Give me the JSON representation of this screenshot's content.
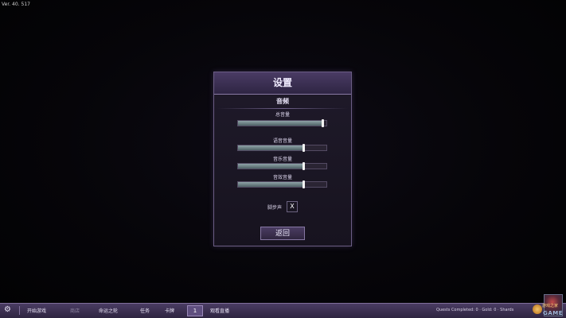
{
  "version": "Ver. 40. 517",
  "settings": {
    "title": "设置",
    "section": "音频",
    "sliders": [
      {
        "label": "总音量",
        "level": 0.96
      },
      {
        "label": "语音音量",
        "level": 0.75
      },
      {
        "label": "音乐音量",
        "level": 0.75
      },
      {
        "label": "音效音量",
        "level": 0.75
      }
    ],
    "footsteps": {
      "label": "脚步声",
      "value": "X"
    },
    "back_label": "返回"
  },
  "bottombar": {
    "gear_icon": "gear-icon",
    "tabs": [
      {
        "label": "开始游戏",
        "dim": false
      },
      {
        "label": "商店",
        "dim": true
      },
      {
        "label": "命运之轮",
        "dim": false
      },
      {
        "label": "任务",
        "dim": false
      },
      {
        "label": "卡牌",
        "dim": false
      },
      {
        "label": "观看直播",
        "dim": false
      }
    ],
    "indicator": "1",
    "status": "Quests Completed: 0 · Gold: 0 · Shards"
  },
  "watermark": {
    "cn": "游戏之家",
    "en": "GAME"
  }
}
